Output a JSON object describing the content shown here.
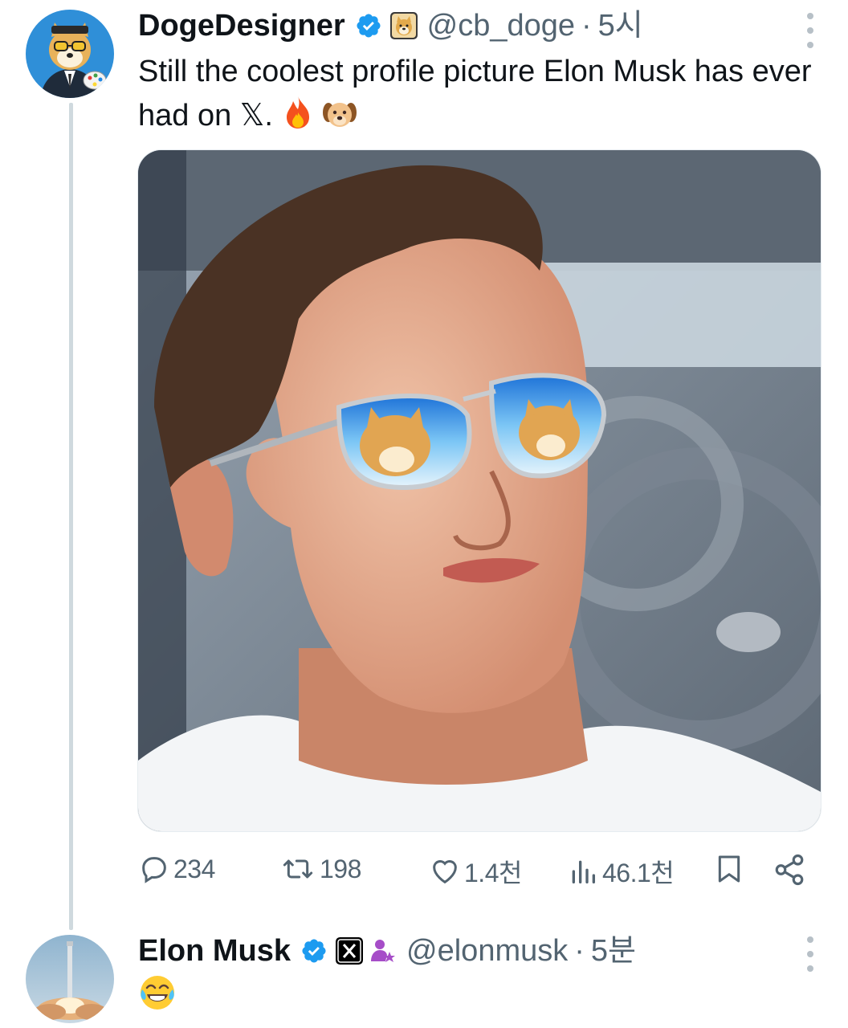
{
  "tweet1": {
    "display_name": "DogeDesigner",
    "handle": "@cb_doge",
    "separator": "·",
    "time": "5시",
    "text": "Still the coolest profile picture Elon Musk has ever had on 𝕏.",
    "emojis": [
      "fire-emoji",
      "dog-face-emoji"
    ],
    "image_alt_subject": "man-with-doge-reflective-sunglasses",
    "stats": {
      "replies": "234",
      "reposts": "198",
      "likes": "1.4천",
      "views": "46.1천"
    }
  },
  "tweet2": {
    "display_name": "Elon Musk",
    "handle": "@elonmusk",
    "separator": "·",
    "time": "5분",
    "reply_emoji": "face-with-tears-of-joy-emoji"
  },
  "colors": {
    "text": "#0f1419",
    "secondary": "#536471",
    "verified": "#1d9bf0",
    "thread_line": "#cfd9de"
  }
}
